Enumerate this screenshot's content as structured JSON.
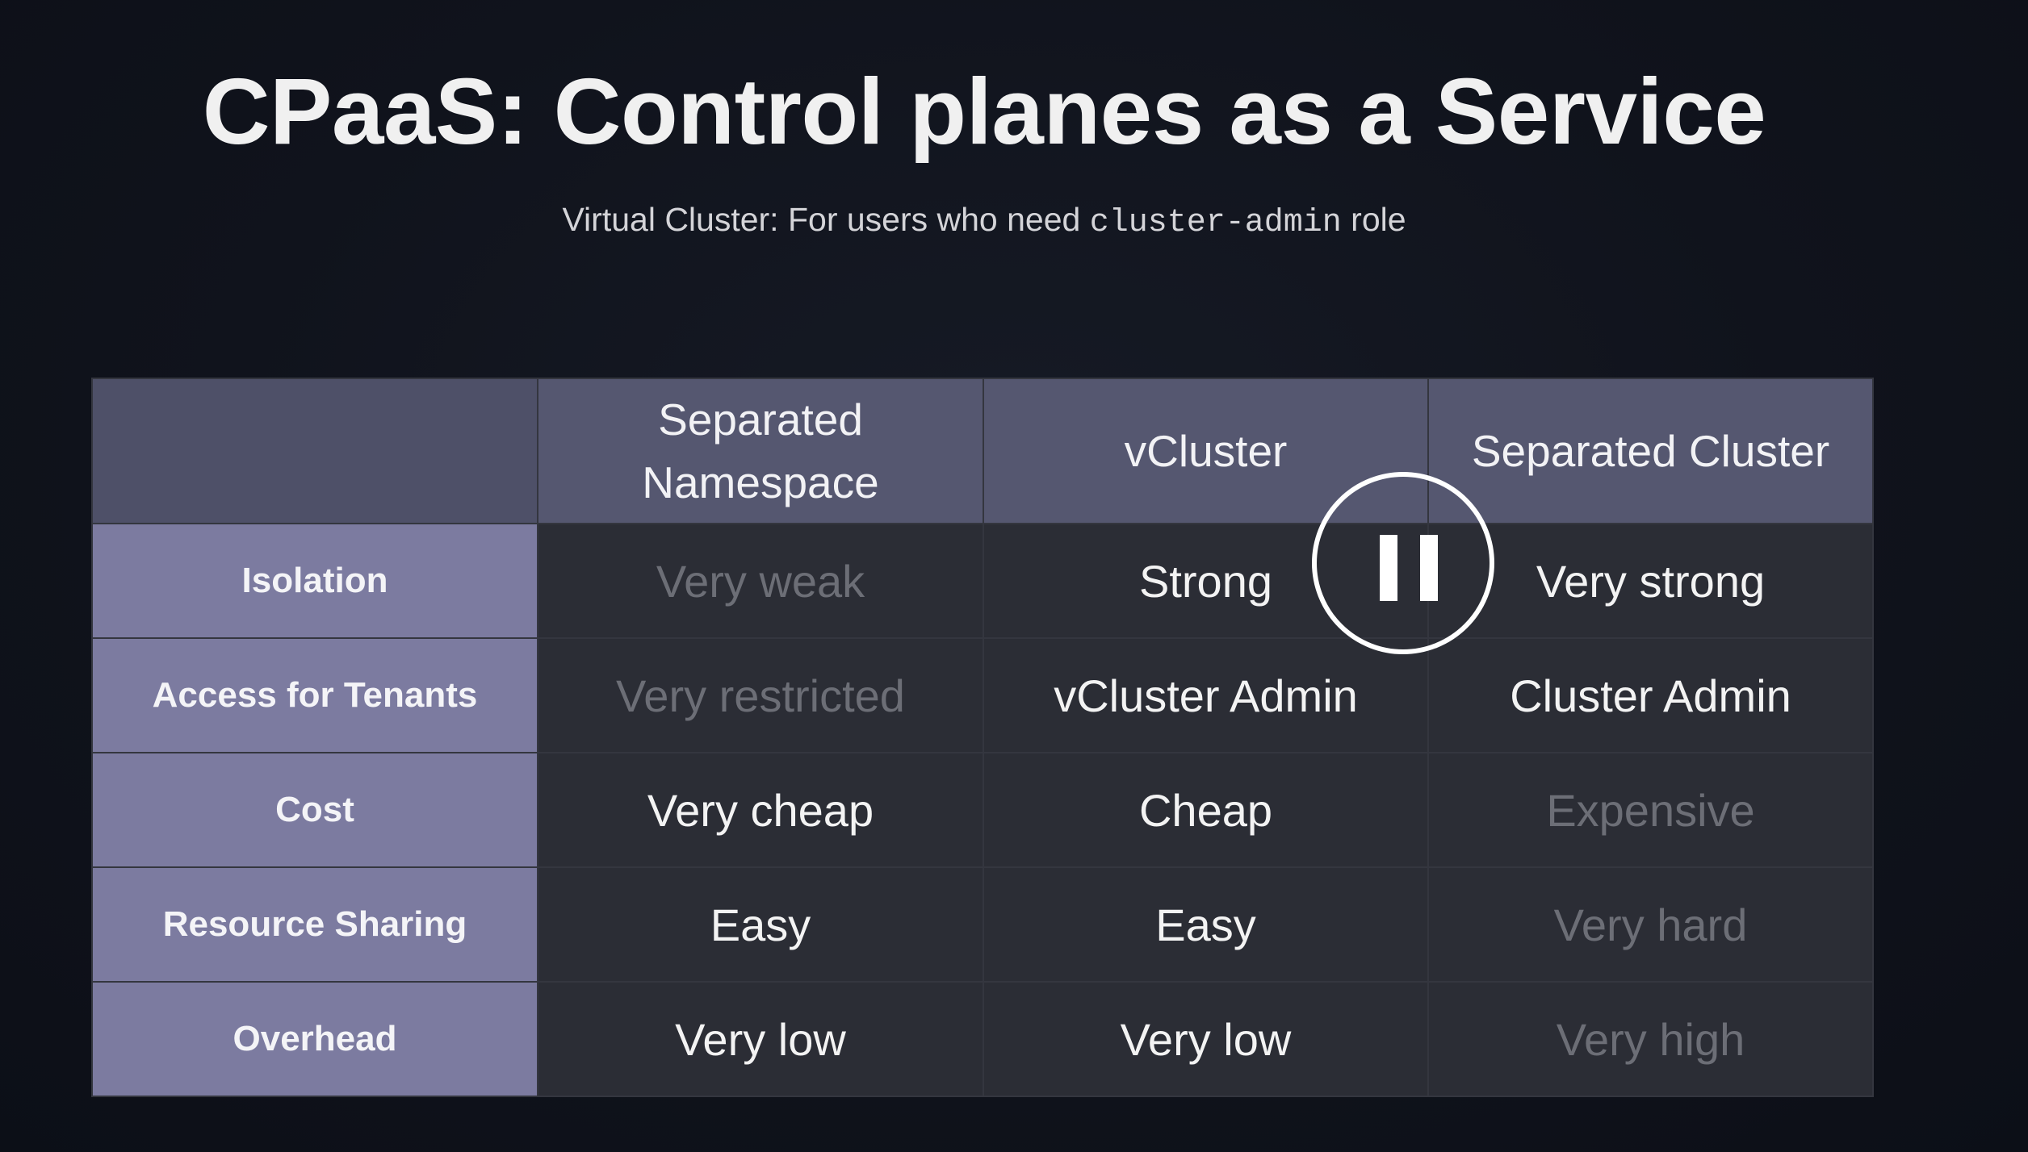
{
  "slide": {
    "title": "CPaaS: Control planes as a Service",
    "subtitle_prefix": "Virtual Cluster: For users who need ",
    "subtitle_code": "cluster-admin",
    "subtitle_suffix": " role"
  },
  "table": {
    "columns": [
      "",
      "Separated Namespace",
      "vCluster",
      "Separated Cluster"
    ],
    "rows": [
      {
        "label": "Isolation",
        "cells": [
          "Very weak",
          "Strong",
          "Very strong"
        ],
        "dim": [
          true,
          false,
          false
        ]
      },
      {
        "label": "Access for Tenants",
        "cells": [
          "Very restricted",
          "vCluster Admin",
          "Cluster Admin"
        ],
        "dim": [
          true,
          false,
          false
        ]
      },
      {
        "label": "Cost",
        "cells": [
          "Very cheap",
          "Cheap",
          "Expensive"
        ],
        "dim": [
          false,
          false,
          true
        ]
      },
      {
        "label": "Resource Sharing",
        "cells": [
          "Easy",
          "Easy",
          "Very hard"
        ],
        "dim": [
          false,
          false,
          true
        ]
      },
      {
        "label": "Overhead",
        "cells": [
          "Very low",
          "Very low",
          "Very high"
        ],
        "dim": [
          false,
          false,
          true
        ]
      }
    ]
  },
  "colors": {
    "background": "#10131c",
    "header_bg": "#555770",
    "row_label_bg": "#7c7ba0",
    "cell_bg": "#2b2d35",
    "text": "#f3f3f3",
    "dim_text": "#6c6e76"
  },
  "player": {
    "pause_icon": "pause-icon"
  }
}
